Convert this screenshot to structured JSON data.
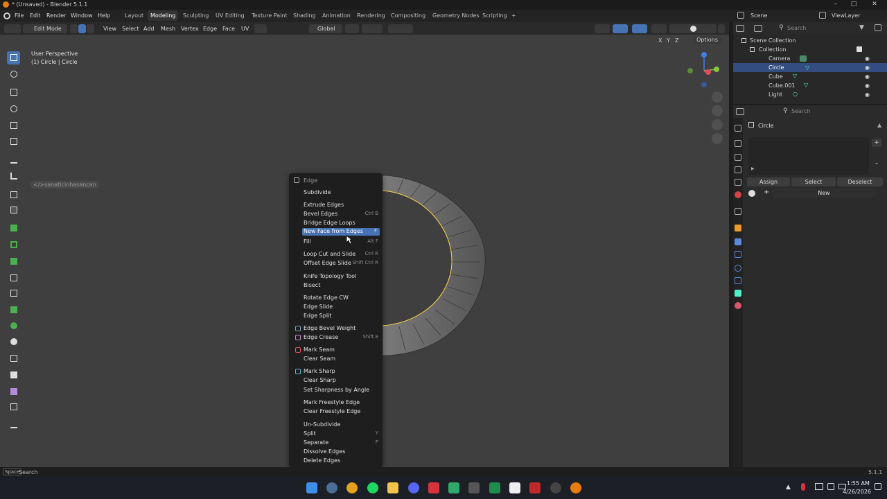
{
  "window": {
    "title": "* (Unsaved) - Blender 5.1.1"
  },
  "menubar": [
    "File",
    "Edit",
    "Render",
    "Window",
    "Help"
  ],
  "workspaces": [
    "Layout",
    "Modeling",
    "Sculpting",
    "UV Editing",
    "Texture Paint",
    "Shading",
    "Animation",
    "Rendering",
    "Compositing",
    "Geometry Nodes",
    "Scripting"
  ],
  "active_workspace": "Modeling",
  "scene": {
    "label": "Scene",
    "viewlayer": "ViewLayer"
  },
  "view_header": {
    "mode": "Edit Mode",
    "menus": [
      "View",
      "Select",
      "Add",
      "Mesh",
      "Vertex",
      "Edge",
      "Face",
      "UV"
    ],
    "orientation": "Global",
    "options": "Options",
    "axes": [
      "X",
      "Y",
      "Z"
    ]
  },
  "viewport": {
    "perspective": "User Perspective",
    "object_info": "(1) Circle | Circle",
    "watermark": "</>sanaticinhasancan"
  },
  "context_menu": {
    "title": "Edge",
    "items": [
      {
        "label": "Subdivide",
        "shortcut": ""
      },
      {
        "label": "Extrude Edges",
        "shortcut": ""
      },
      {
        "label": "Bevel Edges",
        "shortcut": "Ctrl B"
      },
      {
        "label": "Bridge Edge Loops",
        "shortcut": ""
      },
      {
        "label": "New Face from Edges",
        "shortcut": "F"
      },
      {
        "label": "Fill",
        "shortcut": "Alt F"
      },
      {
        "label": "Loop Cut and Slide",
        "shortcut": "Ctrl R"
      },
      {
        "label": "Offset Edge Slide",
        "shortcut": "Shift Ctrl R"
      },
      {
        "label": "Knife Topology Tool",
        "shortcut": ""
      },
      {
        "label": "Bisect",
        "shortcut": ""
      },
      {
        "label": "Rotate Edge CW",
        "shortcut": ""
      },
      {
        "label": "Edge Slide",
        "shortcut": ""
      },
      {
        "label": "Edge Split",
        "shortcut": ""
      },
      {
        "label": "Edge Bevel Weight",
        "shortcut": ""
      },
      {
        "label": "Edge Crease",
        "shortcut": "Shift E"
      },
      {
        "label": "Mark Seam",
        "shortcut": ""
      },
      {
        "label": "Clear Seam",
        "shortcut": ""
      },
      {
        "label": "Mark Sharp",
        "shortcut": ""
      },
      {
        "label": "Clear Sharp",
        "shortcut": ""
      },
      {
        "label": "Set Sharpness by Angle",
        "shortcut": ""
      },
      {
        "label": "Mark Freestyle Edge",
        "shortcut": ""
      },
      {
        "label": "Clear Freestyle Edge",
        "shortcut": ""
      },
      {
        "label": "Un-Subdivide",
        "shortcut": ""
      },
      {
        "label": "Split",
        "shortcut": "Y"
      },
      {
        "label": "Separate",
        "shortcut": "P"
      },
      {
        "label": "Dissolve Edges",
        "shortcut": ""
      },
      {
        "label": "Delete Edges",
        "shortcut": ""
      }
    ],
    "highlighted": "New Face from Edges"
  },
  "outliner": {
    "search_placeholder": "Search",
    "root": "Scene Collection",
    "collection": "Collection",
    "objects": [
      "Camera",
      "Circle",
      "Cube",
      "Cube.001",
      "Light"
    ],
    "selected": "Circle"
  },
  "properties": {
    "search_placeholder": "Search",
    "object_name": "Circle",
    "buttons": {
      "assign": "Assign",
      "select": "Select",
      "deselect": "Deselect",
      "new": "New"
    }
  },
  "status": {
    "key": "Space",
    "action": "Search",
    "version": "5.1.1"
  },
  "taskbar": {
    "time": "1:55 AM",
    "date": "4/26/2026"
  },
  "colors": {
    "accent": "#4772b3",
    "selection": "#334d80",
    "edge_highlight": "#ffd84d"
  }
}
